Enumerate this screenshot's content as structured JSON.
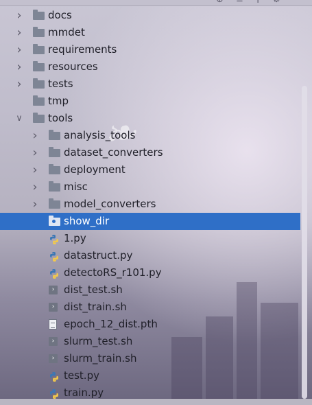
{
  "tree": {
    "rows": [
      {
        "label": "docs",
        "type": "folder",
        "expanded": false
      },
      {
        "label": "mmdet",
        "type": "folder",
        "expanded": false
      },
      {
        "label": "requirements",
        "type": "folder",
        "expanded": false
      },
      {
        "label": "resources",
        "type": "folder",
        "expanded": false
      },
      {
        "label": "tests",
        "type": "folder",
        "expanded": false
      },
      {
        "label": "tmp",
        "type": "folder"
      },
      {
        "label": "tools",
        "type": "folder",
        "expanded": true
      },
      {
        "label": "analysis_tools",
        "type": "folder",
        "expanded": false
      },
      {
        "label": "dataset_converters",
        "type": "folder",
        "expanded": false
      },
      {
        "label": "deployment",
        "type": "folder",
        "expanded": false
      },
      {
        "label": "misc",
        "type": "folder",
        "expanded": false
      },
      {
        "label": "model_converters",
        "type": "folder",
        "expanded": false
      },
      {
        "label": "show_dir",
        "type": "folder",
        "selected": true
      },
      {
        "label": "1.py",
        "type": "python"
      },
      {
        "label": "datastruct.py",
        "type": "python"
      },
      {
        "label": "detectoRS_r101.py",
        "type": "python"
      },
      {
        "label": "dist_test.sh",
        "type": "shell"
      },
      {
        "label": "dist_train.sh",
        "type": "shell"
      },
      {
        "label": "epoch_12_dist.pth",
        "type": "file"
      },
      {
        "label": "slurm_test.sh",
        "type": "shell"
      },
      {
        "label": "slurm_train.sh",
        "type": "shell"
      },
      {
        "label": "test.py",
        "type": "python"
      },
      {
        "label": "train.py",
        "type": "python"
      }
    ]
  },
  "colors": {
    "selection": "#2f6fc7",
    "folder_icon": "#7e8595",
    "python_blue": "#3b77b5",
    "python_yellow": "#f2c94c"
  }
}
